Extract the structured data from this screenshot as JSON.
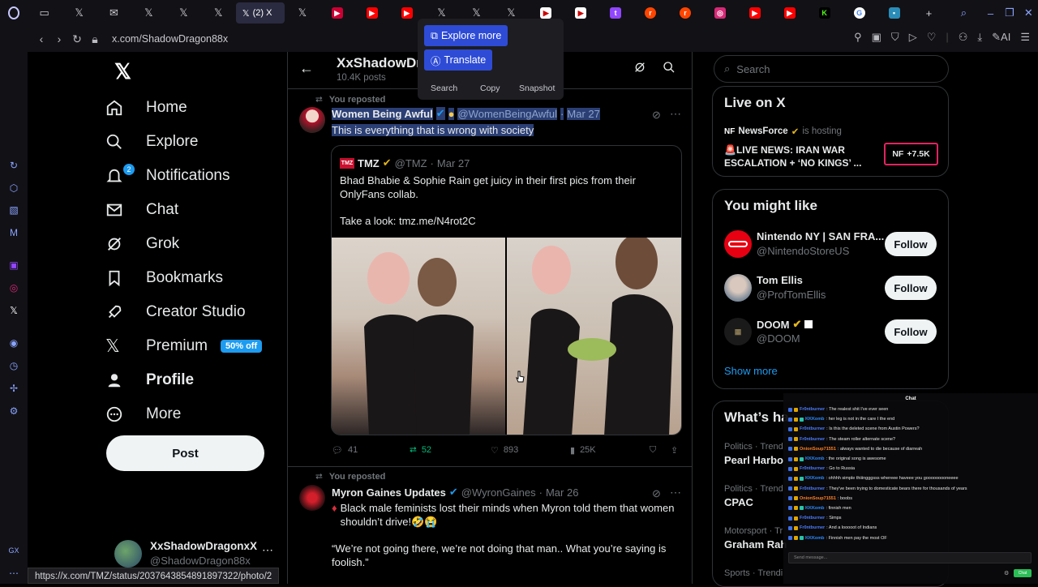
{
  "browser": {
    "active_tab_label": "(2) X",
    "url": "x.com/ShadowDragon88x",
    "status_url": "https://x.com/TMZ/status/2037643854891897322/photo/2",
    "right_ai_label": "AI",
    "gx_label": "GX"
  },
  "nav": {
    "items": [
      {
        "label": "Home",
        "icon": "home-icon"
      },
      {
        "label": "Explore",
        "icon": "search-icon"
      },
      {
        "label": "Notifications",
        "icon": "bell-icon",
        "badge": "2"
      },
      {
        "label": "Chat",
        "icon": "mail-icon"
      },
      {
        "label": "Grok",
        "icon": "grok-icon"
      },
      {
        "label": "Bookmarks",
        "icon": "bookmark-icon"
      },
      {
        "label": "Creator Studio",
        "icon": "rocket-icon"
      },
      {
        "label": "Premium",
        "icon": "x-icon",
        "badge": "50% off"
      },
      {
        "label": "Profile",
        "icon": "person-icon"
      },
      {
        "label": "More",
        "icon": "more-icon"
      }
    ],
    "post_label": "Post",
    "account_name": "XxShadowDragonxX",
    "account_handle": "@ShadowDragon88x"
  },
  "header": {
    "name": "XxShadowDr",
    "posts": "10.4K posts"
  },
  "popup": {
    "explore_more": "Explore more",
    "translate": "Translate",
    "search": "Search",
    "copy": "Copy",
    "snapshot": "Snapshot"
  },
  "post1": {
    "repost": "You reposted",
    "name": "Women Being Awful",
    "handle": "@WomenBeingAwful",
    "date": "Mar 27",
    "text": "This is everything that is wrong with society",
    "quote": {
      "name": "TMZ",
      "handle": "@TMZ",
      "date": "Mar 27",
      "text1": "Bhad Bhabie & Sophie Rain get juicy in their first pics from their OnlyFans collab.",
      "text2": "Take a look: tmz.me/N4rot2C"
    },
    "replies": "41",
    "reposts": "52",
    "likes": "893",
    "views": "25K"
  },
  "post2": {
    "repost": "You reposted",
    "name": "Myron Gaines Updates",
    "handle": "@WyronGaines",
    "date": "Mar 26",
    "text1": "Black male feminists lost their minds when Myron told them that women shouldn’t drive!🤣😭",
    "text2": "“We’re not going there, we’re not doing that man.. What you’re saying is foolish.”"
  },
  "right": {
    "search_placeholder": "Search",
    "live_title": "Live on X",
    "live_host": "NewsForce",
    "live_hosting": "is hosting",
    "live_text": "🚨LIVE NEWS: IRAN WAR ESCALATION + ‘NO KINGS’ ...",
    "live_count": "+7.5K",
    "wtf_title": "You might like",
    "suggestions": [
      {
        "name": "Nintendo NY | SAN FRA...",
        "handle": "@NintendoStoreUS",
        "btn": "Follow"
      },
      {
        "name": "Tom Ellis",
        "handle": "@ProfTomEllis",
        "btn": "Follow"
      },
      {
        "name": "DOOM",
        "handle": "@DOOM",
        "btn": "Follow"
      }
    ],
    "show_more": "Show more",
    "trends_title": "What’s ha",
    "trends": [
      {
        "cat": "Politics · Trend",
        "name": "Pearl Harbo"
      },
      {
        "cat": "Politics · Trend",
        "name": "CPAC"
      },
      {
        "cat": "Motorsport · Tr",
        "name": "Graham Rah"
      },
      {
        "cat": "Sports · Trendi",
        "name": ""
      }
    ]
  },
  "chat": {
    "title": "Chat",
    "input_placeholder": "Send message...",
    "send_label": "Chat",
    "messages": [
      {
        "user": "Fr0ntburner",
        "text": ": The realest shit I've ever seen",
        "color": "blue"
      },
      {
        "user": "KKKomb",
        "text": ": her leg is not in the care I the end",
        "color": "blue2"
      },
      {
        "user": "Fr0ntburner",
        "text": ": Is this the deleted scene from Austin Powers?",
        "color": "blue"
      },
      {
        "user": "Fr0ntburner",
        "text": ": The steam roller alternate scene?",
        "color": "blue"
      },
      {
        "user": "OnionSoup71551",
        "text": ": always wanted to die because of diarreah",
        "color": "orange"
      },
      {
        "user": "KKKomb",
        "text": ": the original song is awesome",
        "color": "blue2"
      },
      {
        "user": "Fr0ntburner",
        "text": ": Go to Russia",
        "color": "blue"
      },
      {
        "user": "KKKomb",
        "text": ": ohhhh simple thiiingggsss whereee haveee you gooooooooneeee",
        "color": "blue2"
      },
      {
        "user": "Fr0ntburner",
        "text": ": They've been trying to domesticate bears there for thousands of years",
        "color": "blue"
      },
      {
        "user": "OnionSoup71551",
        "text": ": boobs",
        "color": "orange"
      },
      {
        "user": "KKKomb",
        "text": ": finnish men",
        "color": "blue2"
      },
      {
        "user": "Fr0ntburner",
        "text": ": Simps",
        "color": "blue"
      },
      {
        "user": "Fr0ntburner",
        "text": ": And a looooot of Indians",
        "color": "blue"
      },
      {
        "user": "KKKomb",
        "text": ": Finnish men pay the most OF",
        "color": "blue2"
      }
    ]
  }
}
